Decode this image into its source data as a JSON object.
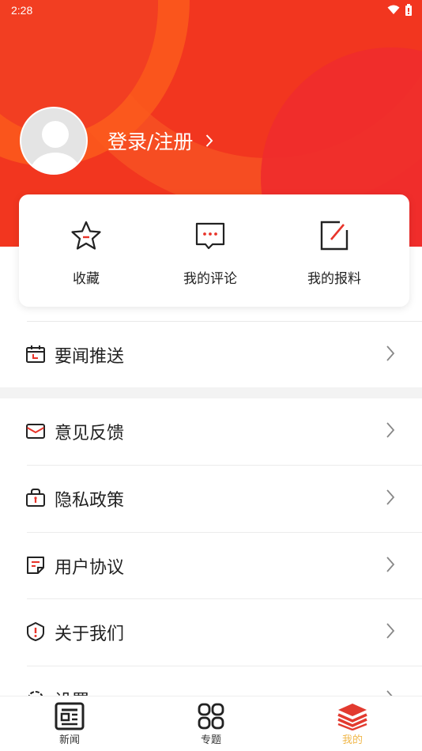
{
  "status_bar": {
    "time": "2:28"
  },
  "profile": {
    "login_label": "登录/注册"
  },
  "quick_actions": [
    {
      "label": "收藏",
      "icon": "star-icon"
    },
    {
      "label": "我的评论",
      "icon": "comment-icon"
    },
    {
      "label": "我的报料",
      "icon": "edit-icon"
    }
  ],
  "menu": {
    "push": {
      "label": "要闻推送",
      "icon": "calendar-icon"
    },
    "feedback": {
      "label": "意见反馈",
      "icon": "envelope-icon"
    },
    "privacy": {
      "label": "隐私政策",
      "icon": "lock-bag-icon"
    },
    "agreement": {
      "label": "用户协议",
      "icon": "document-icon"
    },
    "about": {
      "label": "关于我们",
      "icon": "info-shield-icon"
    },
    "settings": {
      "label": "设置",
      "icon": "gear-icon"
    }
  },
  "bottom_nav": [
    {
      "label": "新闻",
      "icon": "newspaper-icon",
      "active": false
    },
    {
      "label": "专题",
      "icon": "grid-icon",
      "active": false
    },
    {
      "label": "我的",
      "icon": "stack-icon",
      "active": true
    }
  ],
  "colors": {
    "header_red": "#f2361f",
    "accent_red": "#e8342a",
    "active_tab": "#f0b74a"
  }
}
